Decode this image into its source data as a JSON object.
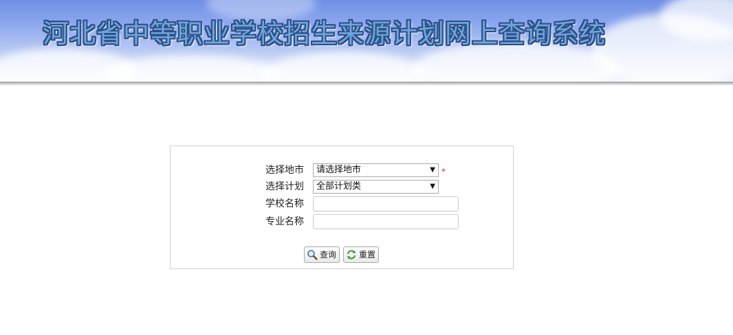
{
  "header": {
    "title": "河北省中等职业学校招生来源计划网上查询系统"
  },
  "form": {
    "city": {
      "label": "选择地市",
      "selected": "请选择地市",
      "required_mark": "*"
    },
    "plan": {
      "label": "选择计划",
      "selected": "全部计划类"
    },
    "school": {
      "label": "学校名称",
      "value": ""
    },
    "major": {
      "label": "专业名称",
      "value": ""
    },
    "buttons": {
      "search_label": "查询",
      "reset_label": "重置"
    }
  },
  "icons": {
    "search": "magnifier-icon",
    "reset": "refresh-icon",
    "dropdown": "chevron-down-icon"
  },
  "colors": {
    "title_fill": "#6ea5dc",
    "title_outline": "#2c4f86",
    "required": "#dd2222"
  }
}
